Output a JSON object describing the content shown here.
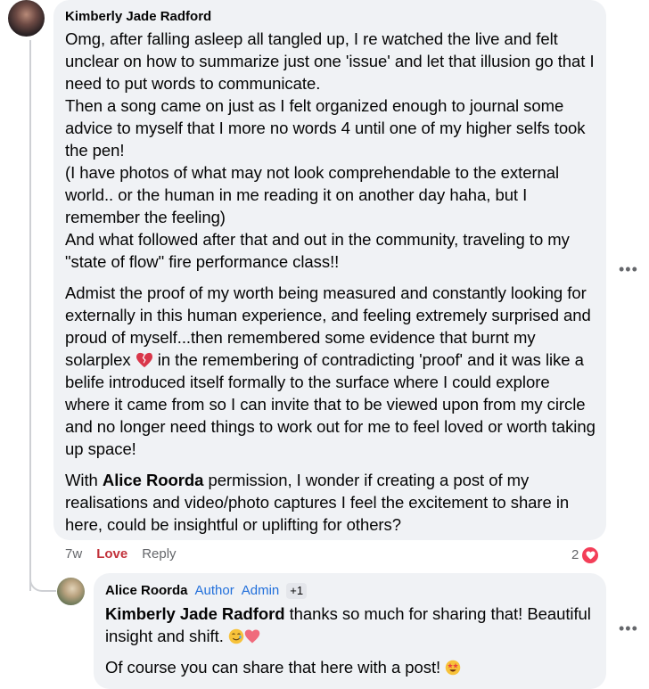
{
  "comment": {
    "author": "Kimberly Jade Radford",
    "paragraphs": [
      "Omg, after falling asleep all tangled up, I re watched the live and felt unclear on how to summarize just one 'issue' and let that illusion go that I need to put words to communicate.",
      "Then a song came on just as I felt organized enough to journal some advice to myself that I more no words 4 until one of my higher selfs took the pen!",
      "(I have photos of what may not look comprehendable to the external world.. or the human in me reading it on another day haha, but I remember the feeling)",
      "And what followed after that and out in the community, traveling to my \"state of flow\" fire performance class!!"
    ],
    "para5_before": "Admist the proof of my worth being measured and constantly looking for externally in this human experience, and feeling extremely surprised and proud of myself...then remembered some evidence that burnt my solarplex",
    "para5_emoji": "broken-heart-emoji",
    "para5_after": "in the remembering of contradicting 'proof' and it was like a belife introduced itself formally to the surface where I could explore where it came from so I can invite that to be viewed upon from my circle and no longer need things to work out for me to feel loved or worth taking up space!",
    "para6_before": "With",
    "para6_mention": "Alice Roorda",
    "para6_after": "permission, I wonder if creating a post of my realisations and video/photo captures I feel the excitement to share in here, could be insightful or uplifting for others?",
    "time": "7w",
    "reaction_label": "Love",
    "reply_label": "Reply",
    "reaction_count": "2",
    "reaction_icon": "heart-icon",
    "more_icon": "more-options-icon"
  },
  "reply": {
    "author": "Alice Roorda",
    "badges": [
      "Author",
      "Admin"
    ],
    "extra_badge": "+1",
    "mention": "Kimberly Jade Radford",
    "text_after_mention": "thanks so much for sharing that! Beautiful insight and shift.",
    "emojis": [
      "smiling-tear-emoji",
      "heart-emoji"
    ],
    "line2": "Of course you can share that here with a post!",
    "line2_emoji": "star-struck-emoji",
    "more_icon": "more-options-icon"
  },
  "colors": {
    "bubble": "#f0f2f5",
    "love": "#c2323b",
    "badge_blue": "#216fdb",
    "heart": "#f33e58"
  }
}
